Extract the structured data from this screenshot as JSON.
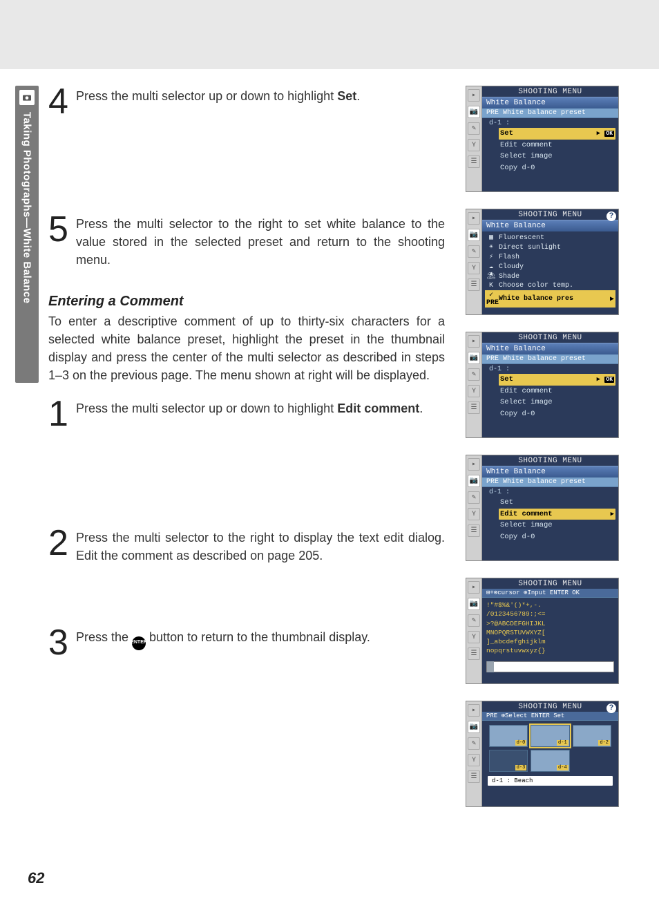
{
  "sidebar": {
    "label": "Taking Photographs—White Balance"
  },
  "pageNumber": "62",
  "step4": {
    "num": "4",
    "text_a": "Press the multi selector up or down to highlight ",
    "text_bold": "Set",
    "text_b": "."
  },
  "step5": {
    "num": "5",
    "text": "Press the multi selector to the right to set white balance to the value stored in the selected preset and return to the shooting menu."
  },
  "comment": {
    "title": "Entering a Comment",
    "desc": "To enter a descriptive comment of up to thirty-six characters for a selected white balance preset, highlight the preset in the thumbnail display and press the center of the multi selector as described in steps 1–3 on the previous page.  The menu shown at right will be displayed."
  },
  "cstep1": {
    "num": "1",
    "text_a": "Press the multi selector up or down to highlight ",
    "text_bold": "Edit comment",
    "text_b": "."
  },
  "cstep2": {
    "num": "2",
    "text": "Press the multi selector to the right to display the text edit dialog.  Edit the comment as described on page 205."
  },
  "cstep3": {
    "num": "3",
    "text_a": "Press the ",
    "text_b": " button to return to the thumbnail display.",
    "icon_label": "ENTER"
  },
  "screens": {
    "common": {
      "title": "SHOOTING MENU",
      "wb_header": "White Balance",
      "preset_sub": "PRE  White balance preset",
      "crumb": "d-1   :",
      "items": {
        "set": "Set",
        "edit": "Edit comment",
        "select": "Select image",
        "copy": "Copy d-0"
      },
      "ok": "OK"
    },
    "wblist": {
      "items": [
        {
          "icon": "▦",
          "label": "Fluorescent"
        },
        {
          "icon": "☀",
          "label": "Direct sunlight"
        },
        {
          "icon": "⚡",
          "label": "Flash"
        },
        {
          "icon": "☁",
          "label": "Cloudy"
        },
        {
          "icon": "⛱",
          "label": "Shade"
        },
        {
          "icon": "K",
          "label": "Choose color temp."
        },
        {
          "icon": "✓ PRE",
          "label": "White balance pres"
        }
      ]
    },
    "textedit": {
      "hint": "⊞+⊗cursor ⊕Input  ENTER OK",
      "chars1": "!\"#$%&'()*+,-.",
      "chars2": "/0123456789:;<=",
      "chars3": ">?@ABCDEFGHIJKL",
      "chars4": "MNOPQRSTUVWXYZ[",
      "chars5": "]_abcdefghijklm",
      "chars6": "nopqrstuvwxyz{}"
    },
    "thumbs": {
      "hint": "PRE   ⊕Select  ENTER Set",
      "labels": [
        "d-0",
        "d-1",
        "d-2",
        "d-3",
        "d-4"
      ],
      "caption": "d-1 : Beach"
    }
  }
}
